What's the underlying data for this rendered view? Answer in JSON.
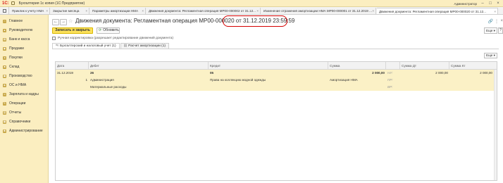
{
  "app": {
    "logo": "1С:",
    "title": "Бухгалтерия 1с копия  (1С:Предприятие)",
    "user": "Администратор"
  },
  "tabs": [
    {
      "label": "Приклик к учету НМА"
    },
    {
      "label": "Закрытие месяца"
    },
    {
      "label": "Параметры амортизации НМА"
    },
    {
      "label": "Движения документа: Регламентная операция МР00-000002 от 31.12..."
    },
    {
      "label": "Изменение отражения амортизации НМА МР00-000001 от 31.12.2019 ..."
    },
    {
      "label": "Движения документа: Регламентная операция МР00-000020 от 31.12..."
    }
  ],
  "sidebar": {
    "items": [
      {
        "label": "Главное",
        "icon": "home-icon"
      },
      {
        "label": "Руководителю",
        "icon": "chart-icon"
      },
      {
        "label": "Банк и касса",
        "icon": "bank-icon"
      },
      {
        "label": "Продажи",
        "icon": "cart-icon"
      },
      {
        "label": "Покупки",
        "icon": "basket-icon"
      },
      {
        "label": "Склад",
        "icon": "warehouse-icon"
      },
      {
        "label": "Производство",
        "icon": "factory-icon"
      },
      {
        "label": "ОС и НМА",
        "icon": "assets-icon"
      },
      {
        "label": "Зарплата и кадры",
        "icon": "people-icon"
      },
      {
        "label": "Операции",
        "icon": "operations-icon"
      },
      {
        "label": "Отчеты",
        "icon": "report-icon"
      },
      {
        "label": "Справочники",
        "icon": "book-icon"
      },
      {
        "label": "Администрирование",
        "icon": "gear-icon"
      }
    ]
  },
  "doc": {
    "title": "Движения документа: Регламентная операция МР00-000020 от",
    "date": "31.12.2019 23:59:59"
  },
  "toolbar": {
    "save_close": "Записать и закрыть",
    "refresh": "Обновить",
    "more": "Еще",
    "help": "?"
  },
  "manual_edit": {
    "label": "Ручная корректировка (разрешает редактирование движений документа)",
    "checked": false
  },
  "inner_tabs": [
    {
      "label": "Бухгалтерский и налоговый учет (1)"
    },
    {
      "label": "Расчет амортизации (1)"
    }
  ],
  "grid": {
    "more": "Еще",
    "columns": [
      "Дата",
      "Дебет",
      "Кредит",
      "Сумма",
      "",
      "Сумма Дт",
      "Сумма Кт"
    ],
    "rows": [
      {
        "date": "31.12.2019",
        "num": "",
        "debit": "26",
        "credit": "05",
        "sum": "2 000,00",
        "code": "НУ:",
        "sum_dt": "2 000,00",
        "sum_kt": "2 000,00"
      },
      {
        "date": "",
        "num": "1",
        "debit": "Администрация",
        "credit": "Права на коллекцию модной одежды",
        "sum": "Амортизация НМА",
        "code": "ПР:",
        "sum_dt": "",
        "sum_kt": ""
      },
      {
        "date": "",
        "num": "",
        "debit": "Материальные расходы",
        "credit": "",
        "sum": "",
        "code": "ВР:",
        "sum_dt": "",
        "sum_kt": ""
      }
    ]
  }
}
